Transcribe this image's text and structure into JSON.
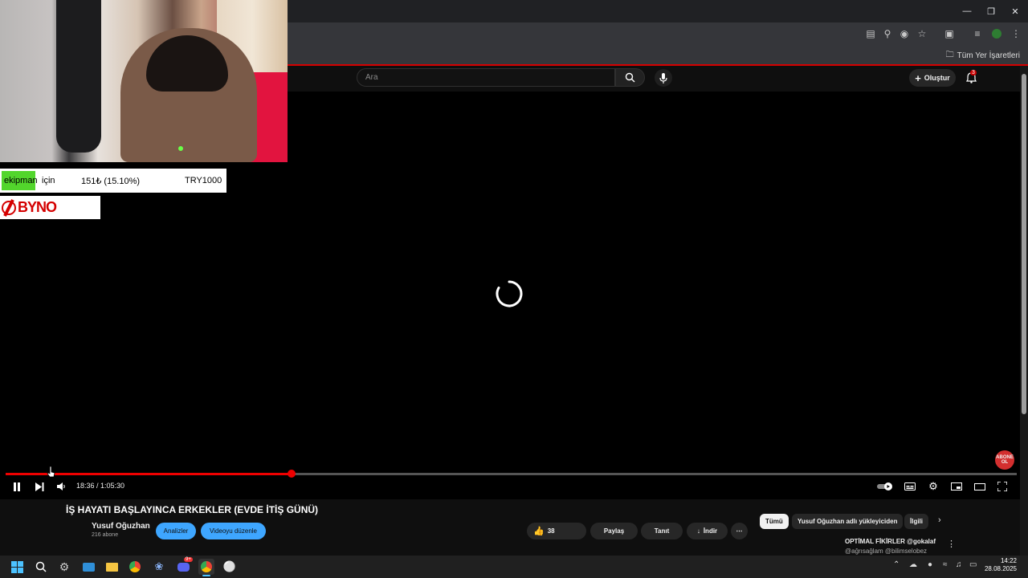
{
  "browser": {
    "bookmarks_all_label": "Tüm Yer İşaretleri"
  },
  "youtube": {
    "search_placeholder": "Ara",
    "create_label": "Oluştur",
    "notification_count": "3"
  },
  "player": {
    "time_display": "18:36 / 1:05:30",
    "progress_fraction": 0.283,
    "subscribe_badge": "ABONE OL"
  },
  "video": {
    "title": "İŞ HAYATI BAŞLAYINCA ERKEKLER (EVDE İTİŞ GÜNÜ)",
    "channel_name": "Yusuf Oğuzhan",
    "subscribers": "216 abone",
    "analytics_label": "Analizler",
    "edit_label": "Videoyu düzenle",
    "like_count": "38",
    "share_label": "Paylaş",
    "promote_label": "Tanıt",
    "download_label": "İndir"
  },
  "related": {
    "chips": [
      "Tümü",
      "Yusuf Oğuzhan adlı yükleyiciden",
      "İlgili"
    ],
    "first_title": "OPTİMAL FİKİRLER @gokalaf",
    "first_sub": "@ağrısağlam @bilimselobez"
  },
  "stream_overlay": {
    "donation_word": "ekipman",
    "donation_for": "için",
    "donation_amount": "151₺ (15.10%)",
    "donation_goal": "TRY1000",
    "sponsor_logo": "BYNO"
  },
  "taskbar": {
    "time": "14:22",
    "date": "28.08.2025",
    "discord_badge": "9+"
  },
  "colors": {
    "youtube_red": "#ff0000",
    "accent_blue": "#3ea6ff",
    "donation_green": "#52d62c"
  }
}
